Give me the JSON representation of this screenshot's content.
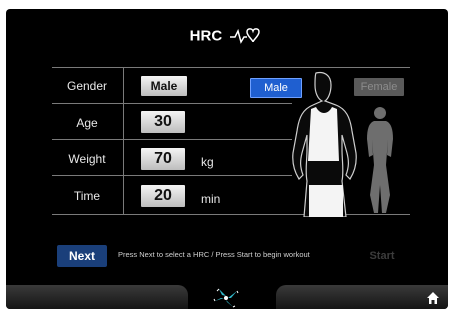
{
  "header": {
    "title": "HRC"
  },
  "fields": [
    {
      "label": "Gender",
      "value": "Male",
      "unit": ""
    },
    {
      "label": "Age",
      "value": "30",
      "unit": ""
    },
    {
      "label": "Weight",
      "value": "70",
      "unit": "kg"
    },
    {
      "label": "Time",
      "value": "20",
      "unit": "min"
    }
  ],
  "gender_options": {
    "male": "Male",
    "female": "Female",
    "selected": "male"
  },
  "footer": {
    "next_label": "Next",
    "hint": "Press Next to select a HRC  /  Press Start to begin workout",
    "start_label": "Start"
  },
  "icons": {
    "title": "heart-rate-icon",
    "center": "fan-icon",
    "home": "home-icon"
  },
  "colors": {
    "background": "#000000",
    "accent": "#1f5fd0",
    "next_button": "#1a3f7a"
  }
}
